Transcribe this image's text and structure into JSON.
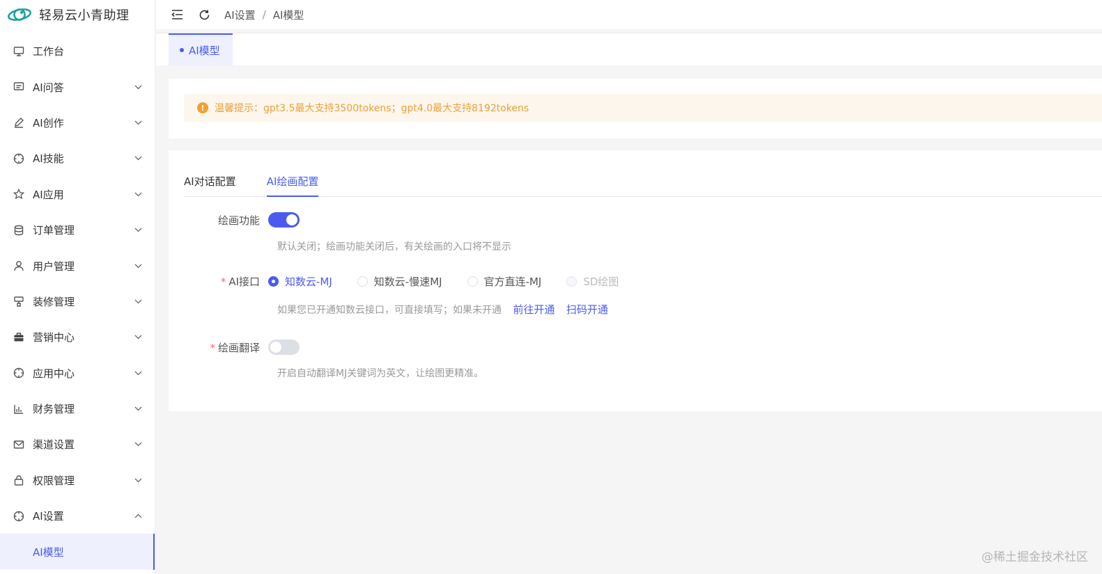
{
  "app": {
    "title": "轻易云小青助理"
  },
  "sidebar": {
    "items": [
      {
        "label": "工作台",
        "icon": "monitor-icon",
        "arrow": ""
      },
      {
        "label": "AI问答",
        "icon": "message-icon",
        "arrow": "down"
      },
      {
        "label": "AI创作",
        "icon": "pen-icon",
        "arrow": "down"
      },
      {
        "label": "AI技能",
        "icon": "compass-icon",
        "arrow": "down"
      },
      {
        "label": "AI应用",
        "icon": "star-icon",
        "arrow": "down"
      },
      {
        "label": "订单管理",
        "icon": "database-icon",
        "arrow": "down"
      },
      {
        "label": "用户管理",
        "icon": "user-icon",
        "arrow": "down"
      },
      {
        "label": "装修管理",
        "icon": "brush-icon",
        "arrow": "down"
      },
      {
        "label": "营销中心",
        "icon": "briefcase-icon",
        "arrow": "down"
      },
      {
        "label": "应用中心",
        "icon": "compass-icon",
        "arrow": "down"
      },
      {
        "label": "财务管理",
        "icon": "chart-icon",
        "arrow": "down"
      },
      {
        "label": "渠道设置",
        "icon": "mail-icon",
        "arrow": "down"
      },
      {
        "label": "权限管理",
        "icon": "lock-icon",
        "arrow": "down"
      },
      {
        "label": "AI设置",
        "icon": "compass-icon",
        "arrow": "up"
      }
    ],
    "active_sub": "AI模型"
  },
  "topbar": {
    "breadcrumb": [
      "AI设置",
      "AI模型"
    ],
    "separator": "/"
  },
  "tagsview": {
    "active_tag": "AI模型"
  },
  "notice": {
    "text": "温馨提示：gpt3.5最大支持3500tokens；gpt4.0最大支持8192tokens",
    "icon": "!"
  },
  "tabs": [
    {
      "label": "AI对话配置",
      "active": false
    },
    {
      "label": "AI绘画配置",
      "active": true
    }
  ],
  "form": {
    "drawing": {
      "label": "绘画功能",
      "enabled": true,
      "help": "默认关闭；绘画功能关闭后，有关绘画的入口将不显示"
    },
    "api": {
      "label": "AI接口",
      "required_mark": "*",
      "options": [
        {
          "label": "知数云-MJ",
          "state": "checked"
        },
        {
          "label": "知数云-慢速MJ",
          "state": "normal"
        },
        {
          "label": "官方直连-MJ",
          "state": "normal"
        },
        {
          "label": "SD绘图",
          "state": "disabled"
        }
      ],
      "help": "如果您已开通知数云接口，可直接填写；如果未开通",
      "link1": "前往开通",
      "link2": "扫码开通"
    },
    "translate": {
      "label": "绘画翻译",
      "required_mark": "*",
      "enabled": false,
      "help": "开启自动翻译MJ关键词为英文，让绘图更精准。"
    }
  },
  "watermark": "@稀土掘金技术社区",
  "colors": {
    "primary": "#4b5bf0",
    "warning": "#e6a23c",
    "required": "#f56c6c"
  }
}
